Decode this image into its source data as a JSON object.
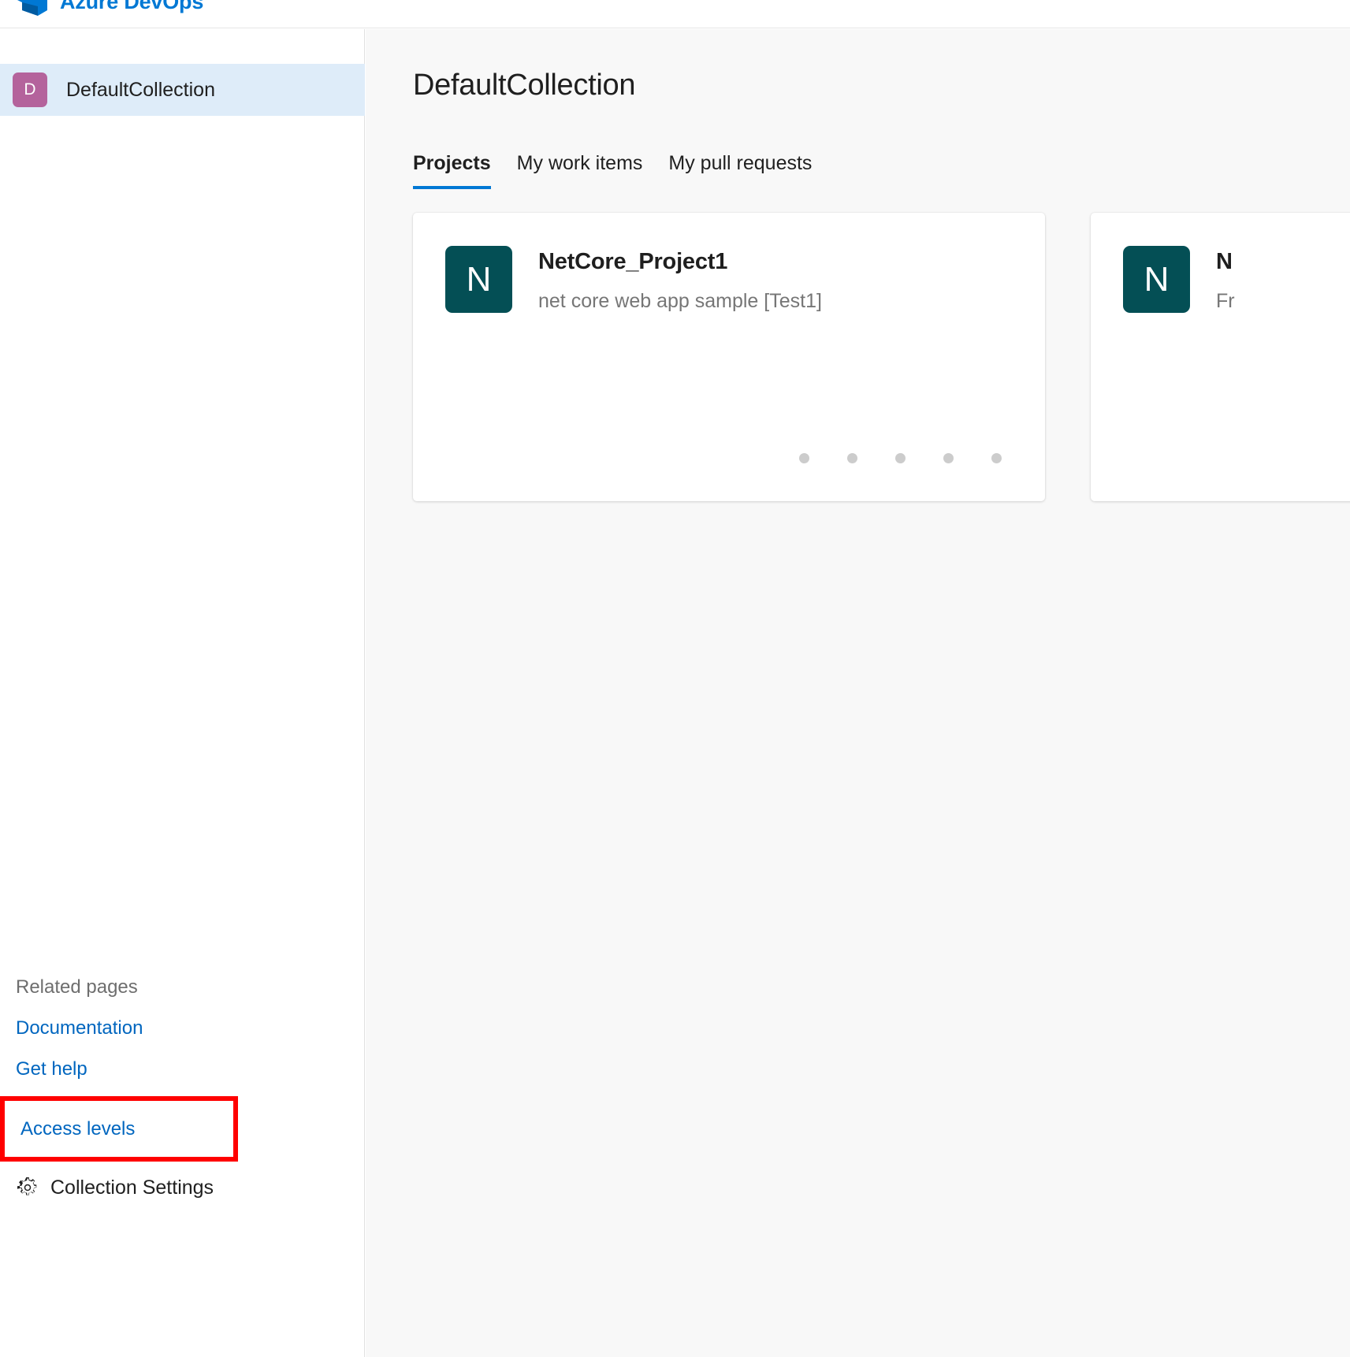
{
  "topbar": {
    "brand": "Azure DevOps",
    "logo_icon": "azure-devops-logo"
  },
  "sidebar": {
    "collection": {
      "initial": "D",
      "name": "DefaultCollection"
    },
    "related": {
      "heading": "Related pages",
      "links": [
        {
          "label": "Documentation"
        },
        {
          "label": "Get help"
        },
        {
          "label": "Access levels",
          "highlighted": true,
          "highlight_color": "#ff0000"
        }
      ]
    },
    "settings": {
      "icon": "gear-icon",
      "label": "Collection Settings"
    }
  },
  "main": {
    "title": "DefaultCollection",
    "tabs": [
      {
        "label": "Projects",
        "active": true
      },
      {
        "label": "My work items",
        "active": false
      },
      {
        "label": "My pull requests",
        "active": false
      }
    ],
    "active_tab_color": "#0078d4",
    "projects": [
      {
        "initial": "N",
        "name": "NetCore_Project1",
        "description": "net core web app sample [Test1]",
        "avatar_color": "#044f55",
        "dots": 5
      },
      {
        "initial": "N",
        "name": "N",
        "description": "Fr",
        "avatar_color": "#044f55",
        "dots": 0
      }
    ]
  }
}
